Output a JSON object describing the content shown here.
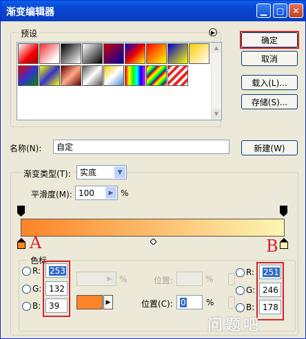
{
  "window": {
    "title": "渐变编辑器"
  },
  "presets": {
    "label": "预设"
  },
  "buttons": {
    "ok": "确定",
    "cancel": "取消",
    "load": "载入(L)...",
    "save": "存储(S)...",
    "new": "新建(W)"
  },
  "name": {
    "label": "名称(N):",
    "value": "自定"
  },
  "gradient": {
    "type_label": "渐变类型(T):",
    "type_value": "实底",
    "smoothness_label": "平滑度(M):",
    "smoothness_value": "100",
    "smoothness_unit": "%"
  },
  "color_stop": {
    "legend": "色标",
    "left": {
      "r_label": "R:",
      "r": "253",
      "g_label": "G:",
      "g": "132",
      "b_label": "B:",
      "b": "39"
    },
    "right": {
      "r_label": "R:",
      "r": "251",
      "g_label": "G:",
      "g": "246",
      "b_label": "B:",
      "b": "178"
    },
    "opacity_unit": "%",
    "location_label_disabled": "位置:",
    "location_unit_disabled": "%",
    "location_label": "位置(C):",
    "location_value": "0",
    "location_unit": "%",
    "color": "#fd8427"
  },
  "annotations": {
    "a": "A",
    "b": "B"
  },
  "watermark": "问题吧"
}
